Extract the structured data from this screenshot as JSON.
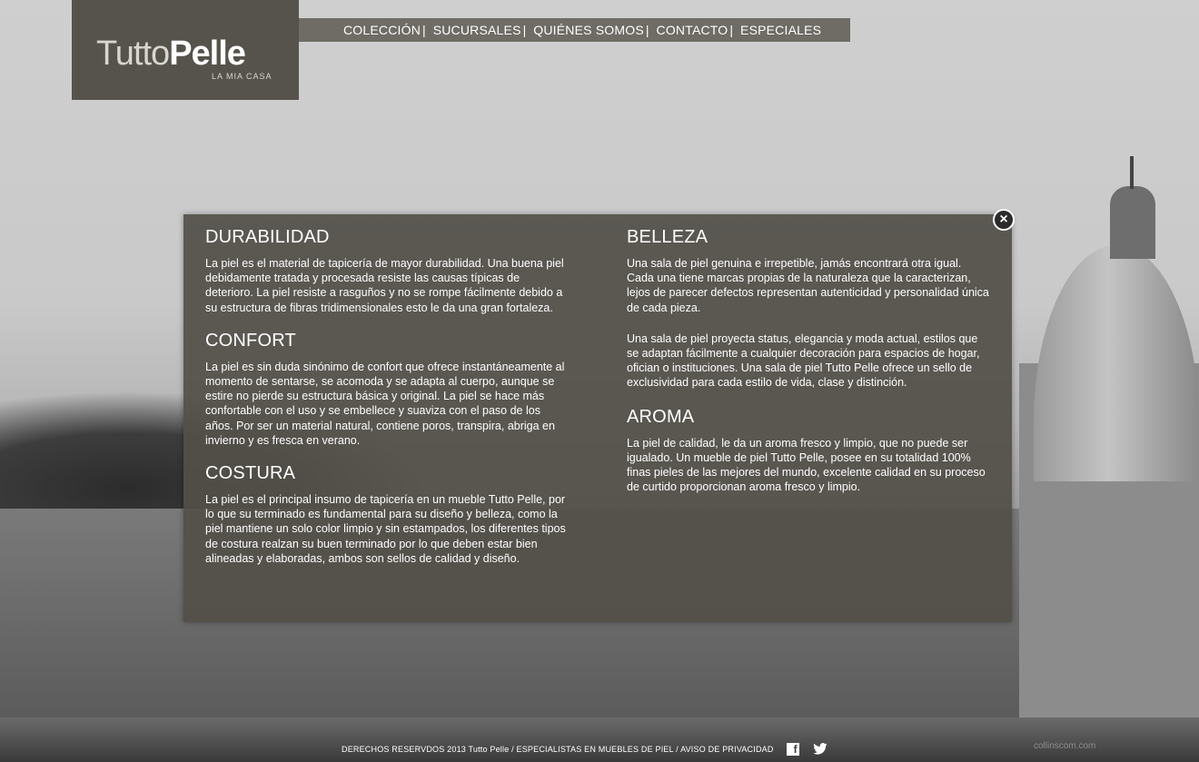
{
  "logo": {
    "part1": "Tutto",
    "part2": "Pelle",
    "tagline": "LA MIA CASA"
  },
  "nav": {
    "items": [
      "COLECCIÓN",
      "SUCURSALES",
      "QUIÉNES SOMOS",
      "CONTACTO",
      "ESPECIALES"
    ],
    "separator": "|"
  },
  "panel": {
    "left": [
      {
        "title": "DURABILIDAD",
        "text": "La piel es el material de tapicería de mayor durabilidad. Una buena piel debidamente tratada y procesada resiste las causas típicas de deterioro. La piel resiste a rasguños y no se rompe fácilmente debido a su estructura de fibras tridimensionales esto le da una gran fortaleza."
      },
      {
        "title": "CONFORT",
        "text": "La piel es sin duda sinónimo de confort que ofrece instantáneamente al momento de sentarse, se acomoda y se adapta al cuerpo, aunque se estire no pierde su estructura básica y original. La piel se hace más confortable con el uso y se embellece y suaviza con el paso de los años. Por ser un material natural, contiene poros, transpira, abriga en invierno y es fresca en verano."
      },
      {
        "title": "COSTURA",
        "text": "La piel es el principal insumo de tapicería en un mueble Tutto Pelle, por lo que su terminado es fundamental para su diseño y belleza, como la piel mantiene un solo color limpio y sin estampados, los diferentes tipos de costura realzan su buen terminado por lo que deben estar bien alineadas y elaboradas, ambos son sellos de calidad y diseño."
      }
    ],
    "right": [
      {
        "title": "BELLEZA",
        "text": "Una sala de piel genuina e irrepetible, jamás encontrará otra igual. Cada una tiene marcas propias de la naturaleza que la caracterizan, lejos de parecer defectos representan autenticidad y personalidad única de cada pieza.",
        "text2": "Una sala de piel proyecta status, elegancia y moda actual, estilos que se adaptan fácilmente a cualquier decoración para espacios de hogar, ofician o instituciones. Una sala de piel Tutto Pelle ofrece un sello de exclusividad para cada estilo de vida, clase y distinción."
      },
      {
        "title": "AROMA",
        "text": "La piel de calidad, le da un aroma fresco y limpio, que no puede ser igualado. Un mueble de piel Tutto Pelle, posee en su totalidad 100% finas pieles de las mejores del mundo, excelente calidad en su proceso de curtido proporcionan aroma fresco y limpio."
      }
    ],
    "close_label": "×"
  },
  "footer": {
    "text": "DERECHOS RESERVDOS 2013 Tutto Pelle / ESPECIALISTAS EN MUEBLES DE PIEL / AVISO DE PRIVACIDAD",
    "facebook_glyph": "f",
    "watermark": "collinscom.com"
  },
  "colors": {
    "panel": "#525048",
    "logo_bg": "#56534c",
    "nav_bg": "#6e6c65"
  },
  "icons": [
    "close-icon",
    "facebook-icon",
    "twitter-icon"
  ]
}
